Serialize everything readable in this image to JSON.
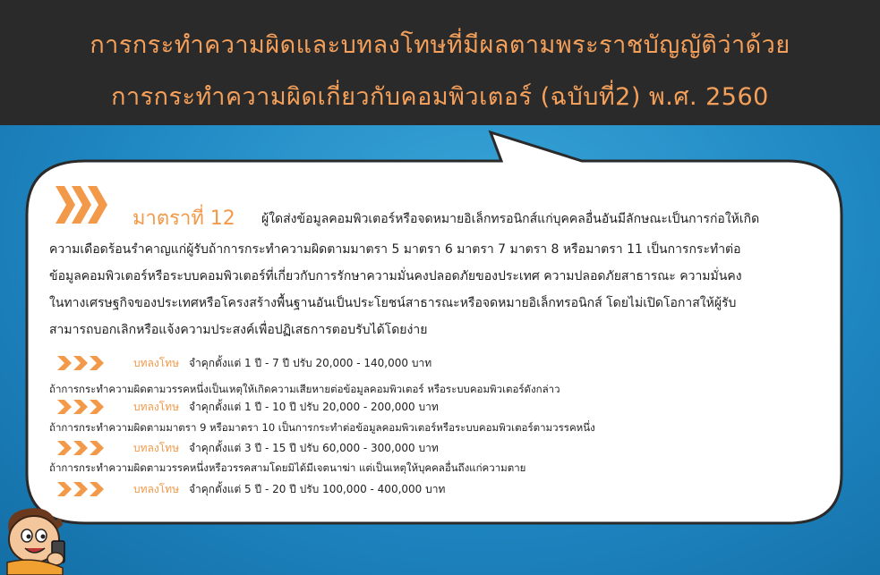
{
  "header": {
    "title_line1": "การกระทำความผิดและบทลงโทษที่มีผลตามพระราชบัญญัติว่าด้วย",
    "title_line2": "การกระทำความผิดเกี่ยวกับคอมพิวเตอร์ (ฉบับที่2) พ.ศ. 2560"
  },
  "section": {
    "title": "มาตราที่ 12",
    "first_line": "ผู้ใดส่งข้อมูลคอมพิวเตอร์หรือจดหมายอิเล็กทรอนิกส์แก่บุคคลอื่นอันมีลักษณะเป็นการก่อให้เกิด",
    "paragraph_lines": [
      "ความเดือดร้อนรำคาญแก่ผู้รับถ้าการกระทำความผิดตามมาตรา 5 มาตรา 6 มาตรา 7 มาตรา 8 หรือมาตรา 11 เป็นการกระทำต่อ",
      "ข้อมูลคอมพิวเตอร์หรือระบบคอมพิวเตอร์ที่เกี่ยวกับการรักษาความมั่นคงปลอดภัยของประเทศ ความปลอดภัยสาธารณะ ความมั่นคง",
      "ในทางเศรษฐกิจของประเทศหรือโครงสร้างพื้นฐานอันเป็นประโยชน์สาธารณะหรือจดหมายอิเล็กทรอนิกส์ โดยไม่เปิดโอกาสให้ผู้รับ",
      "สามารถบอกเลิกหรือแจ้งความประสงค์เพื่อปฏิเสธการตอบรับได้โดยง่าย"
    ],
    "penalty_label": "บทลงโทษ",
    "penalties": [
      "จำคุกตั้งแต่ 1 ปี - 7 ปี  ปรับ 20,000 - 140,000 บาท",
      "จำคุกตั้งแต่ 1 ปี - 10 ปี  ปรับ 20,000 - 200,000 บาท",
      "จำคุกตั้งแต่ 3 ปี - 15 ปี  ปรับ 60,000 - 300,000 บาท",
      "จำคุกตั้งแต่ 5 ปี - 20 ปี  ปรับ 100,000 - 400,000 บาท"
    ],
    "conditions": [
      "ถ้าการกระทำความผิดตามวรรคหนึ่งเป็นเหตุให้เกิดความเสียหายต่อข้อมูลคอมพิวเตอร์ หรือระบบคอมพิวเตอร์ดังกล่าว",
      "ถ้าการกระทำความผิดตามมาตรา 9 หรือมาตรา 10 เป็นการกระทำต่อข้อมูลคอมพิวเตอร์หรือระบบคอมพิวเตอร์ตามวรรคหนึ่ง",
      "ถ้าการกระทำความผิดตามวรรคหนึ่งหรือวรรคสามโดยมิได้มีเจตนาฆ่า แต่เป็นเหตุให้บุคคลอื่นถึงแก่ความตาย"
    ]
  },
  "colors": {
    "accent": "#f29a4a",
    "header_bg": "#2a2a2a",
    "background": "#1f87c2",
    "bubble": "#ffffff"
  },
  "icons": {
    "chevrons": "triple-chevron-right-icon",
    "mascot": "boy-with-phone-icon"
  }
}
